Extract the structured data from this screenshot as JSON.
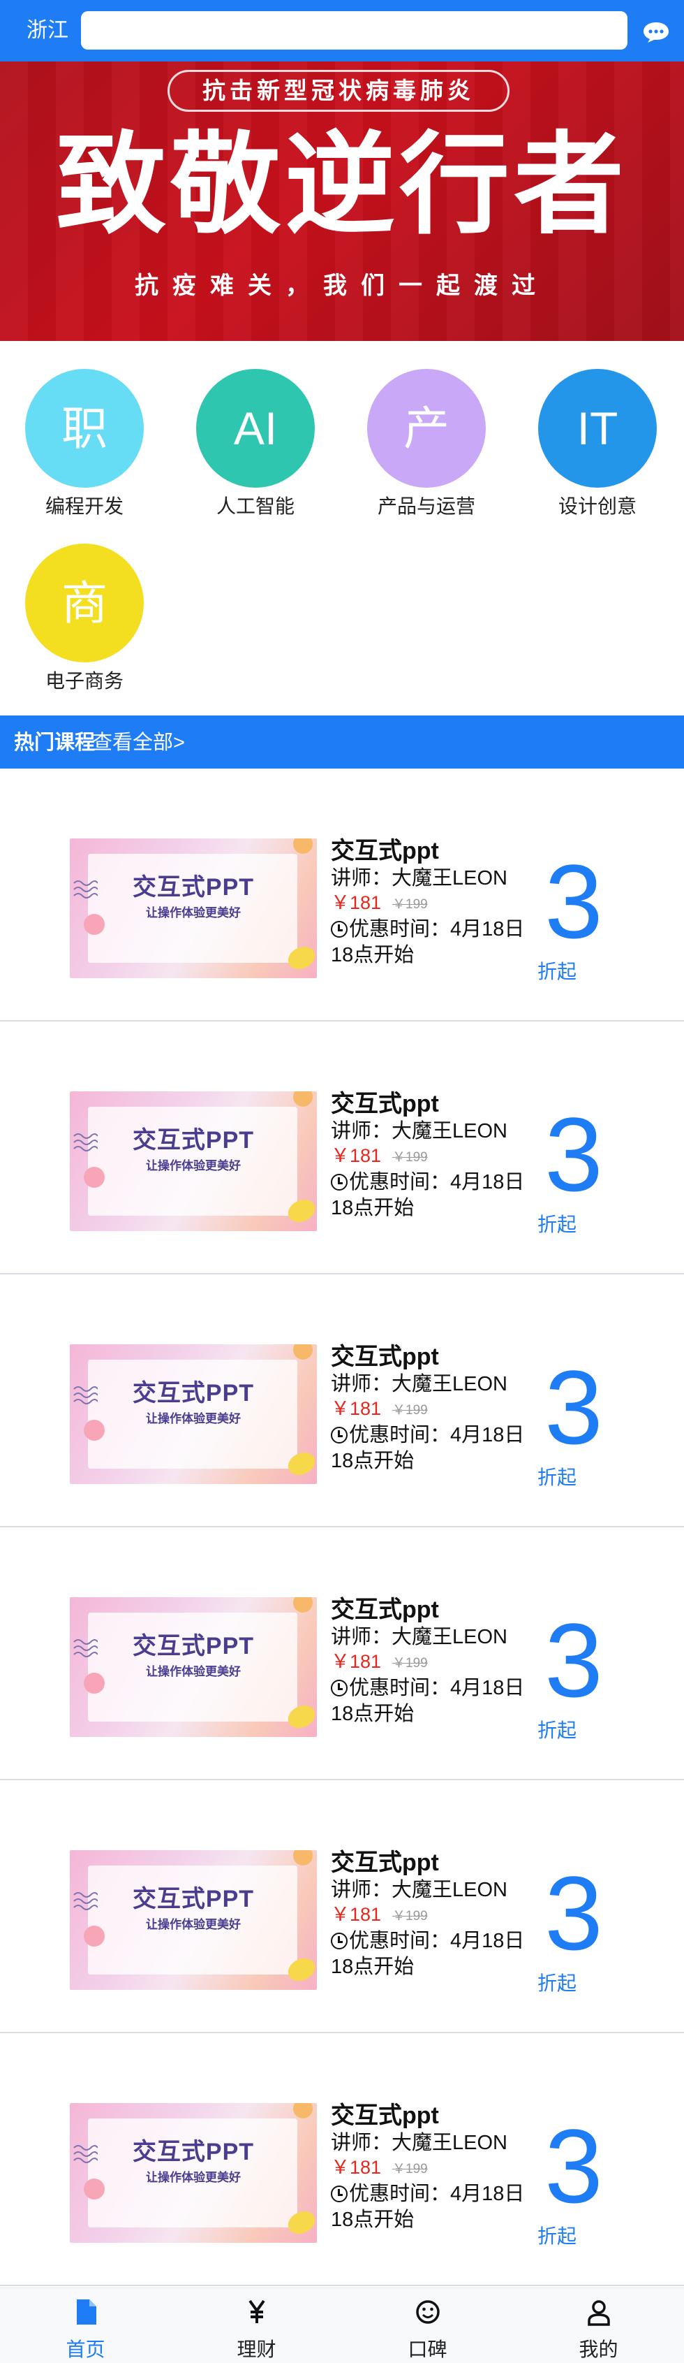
{
  "header": {
    "city": "浙江",
    "search_value": "",
    "chat_icon": "chat-bubble-icon"
  },
  "banner": {
    "pill": "抗击新型冠状病毒肺炎",
    "title": "致敬逆行者",
    "subtitle": "抗疫难关，我们一起渡过"
  },
  "categories": [
    {
      "glyph": "职",
      "label": "编程开发",
      "color": "#66dcf5"
    },
    {
      "glyph": "AI",
      "label": "人工智能",
      "color": "#2ec6ae"
    },
    {
      "glyph": "产",
      "label": "产品与运营",
      "color": "#c8a8f7"
    },
    {
      "glyph": "IT",
      "label": "设计创意",
      "color": "#2496ea"
    },
    {
      "glyph": "商",
      "label": "电子商务",
      "color": "#f3df1f"
    }
  ],
  "hot": {
    "title": "热门课程",
    "view_all": "查看全部>"
  },
  "courses": [
    {
      "thumb_title": "交互式PPT",
      "thumb_sub": "让操作体验更美好",
      "title": "交互式ppt",
      "teacher": "讲师：大魔王LEON",
      "price": "￥181",
      "old_price": "￥199",
      "time": "优惠时间：4月18日18点开始",
      "discount": "3",
      "discount_unit": "折起"
    },
    {
      "thumb_title": "交互式PPT",
      "thumb_sub": "让操作体验更美好",
      "title": "交互式ppt",
      "teacher": "讲师：大魔王LEON",
      "price": "￥181",
      "old_price": "￥199",
      "time": "优惠时间：4月18日18点开始",
      "discount": "3",
      "discount_unit": "折起"
    },
    {
      "thumb_title": "交互式PPT",
      "thumb_sub": "让操作体验更美好",
      "title": "交互式ppt",
      "teacher": "讲师：大魔王LEON",
      "price": "￥181",
      "old_price": "￥199",
      "time": "优惠时间：4月18日18点开始",
      "discount": "3",
      "discount_unit": "折起"
    },
    {
      "thumb_title": "交互式PPT",
      "thumb_sub": "让操作体验更美好",
      "title": "交互式ppt",
      "teacher": "讲师：大魔王LEON",
      "price": "￥181",
      "old_price": "￥199",
      "time": "优惠时间：4月18日18点开始",
      "discount": "3",
      "discount_unit": "折起"
    },
    {
      "thumb_title": "交互式PPT",
      "thumb_sub": "让操作体验更美好",
      "title": "交互式ppt",
      "teacher": "讲师：大魔王LEON",
      "price": "￥181",
      "old_price": "￥199",
      "time": "优惠时间：4月18日18点开始",
      "discount": "3",
      "discount_unit": "折起"
    },
    {
      "thumb_title": "交互式PPT",
      "thumb_sub": "让操作体验更美好",
      "title": "交互式ppt",
      "teacher": "讲师：大魔王LEON",
      "price": "￥181",
      "old_price": "￥199",
      "time": "优惠时间：4月18日18点开始",
      "discount": "3",
      "discount_unit": "折起"
    }
  ],
  "tabbar": [
    {
      "label": "首页",
      "icon": "document-icon",
      "active": true
    },
    {
      "label": "理财",
      "icon": "yen-icon",
      "active": false
    },
    {
      "label": "口碑",
      "icon": "smiley-icon",
      "active": false
    },
    {
      "label": "我的",
      "icon": "user-icon",
      "active": false
    }
  ],
  "colors": {
    "primary": "#1e7cf5",
    "price_red": "#e8261d",
    "banner_red": "#c8101c"
  }
}
